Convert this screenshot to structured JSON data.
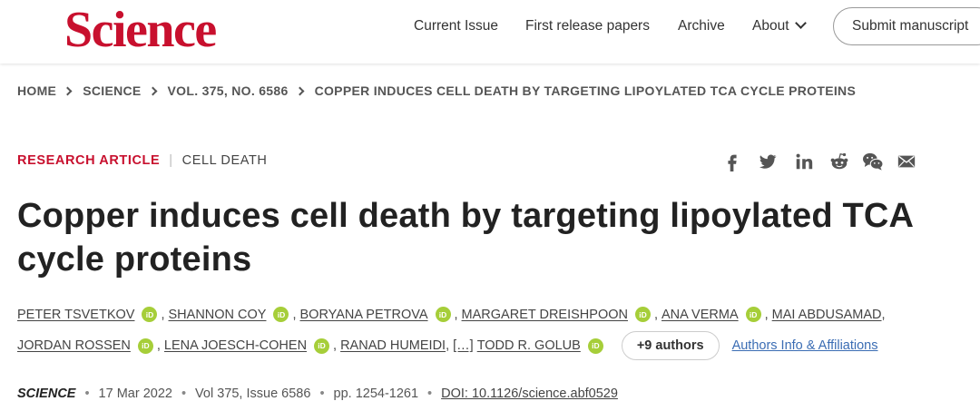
{
  "header": {
    "logo": "Science",
    "nav": {
      "current_issue": "Current Issue",
      "first_release": "First release papers",
      "archive": "Archive",
      "about": "About"
    },
    "submit_label": "Submit manuscript"
  },
  "breadcrumb": {
    "items": [
      "HOME",
      "SCIENCE",
      "VOL. 375, NO. 6586",
      "COPPER INDUCES CELL DEATH BY TARGETING LIPOYLATED TCA CYCLE PROTEINS"
    ]
  },
  "article": {
    "type_primary": "RESEARCH ARTICLE",
    "type_divider": "|",
    "type_secondary": "CELL DEATH",
    "title": "Copper induces cell death by targeting lipoylated TCA cycle proteins",
    "authors_row1": [
      "PETER TSVETKOV",
      "SHANNON COY",
      "BORYANA PETROVA",
      "MARGARET DREISHPOON",
      "ANA VERMA",
      "MAI ABDUSAMAD"
    ],
    "authors_row2": [
      "JORDAN ROSSEN",
      "LENA JOESCH-COHEN",
      "RANAD HUMEIDI"
    ],
    "ellipsis": "[…]",
    "last_author": "TODD R. GOLUB",
    "orcid_label": "iD",
    "more_authors": "+9 authors",
    "affiliations_link": "Authors Info & Affiliations",
    "journal": "SCIENCE",
    "date": "17 Mar 2022",
    "volume_issue": "Vol 375, Issue 6586",
    "pages": "pp. 1254-1261",
    "doi": "DOI: 10.1126/science.abf0529"
  },
  "share_icons": [
    "facebook-icon",
    "twitter-icon",
    "linkedin-icon",
    "reddit-icon",
    "wechat-icon",
    "email-icon"
  ],
  "colors": {
    "brand": "#c8102e",
    "orcid": "#a6ce39",
    "link": "#3b6db4"
  }
}
